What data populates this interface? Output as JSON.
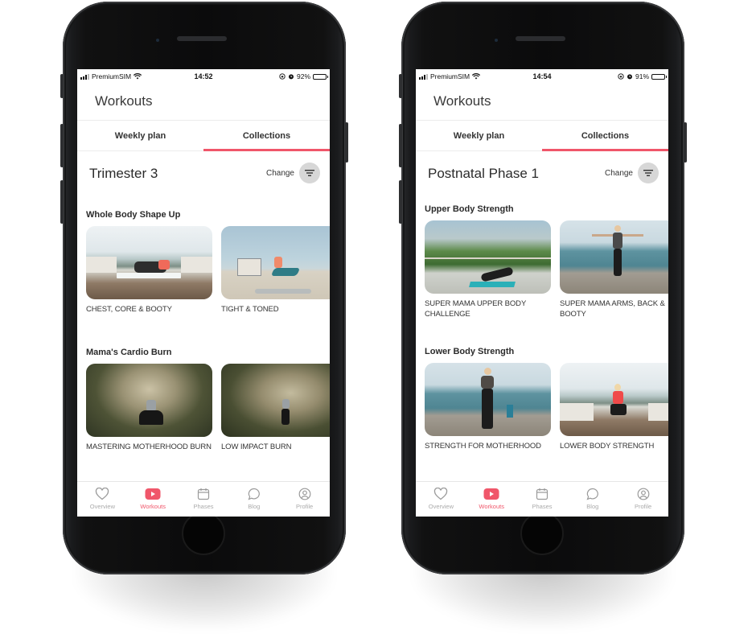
{
  "phones": [
    {
      "status": {
        "carrier": "PremiumSIM",
        "time": "14:52",
        "battery": "92%",
        "battery_level": 0.92
      },
      "header_title": "Workouts",
      "tabs": [
        {
          "label": "Weekly plan",
          "active": false
        },
        {
          "label": "Collections",
          "active": true
        }
      ],
      "phase_title": "Trimester 3",
      "change_label": "Change",
      "sections": [
        {
          "title": "Whole Body Shape Up",
          "cards": [
            {
              "label": "CHEST, CORE & BOOTY",
              "scene": "terrace"
            },
            {
              "label": "TIGHT & TONED",
              "scene": "beach"
            }
          ]
        },
        {
          "title": "Mama's Cardio Burn",
          "cards": [
            {
              "label": "MASTERING MOTHERHOOD BURN",
              "scene": "forest"
            },
            {
              "label": "LOW IMPACT BURN",
              "scene": "forest"
            }
          ]
        }
      ],
      "nav": [
        {
          "label": "Overview",
          "icon": "heart-icon",
          "active": false
        },
        {
          "label": "Workouts",
          "icon": "play-icon",
          "active": true
        },
        {
          "label": "Phases",
          "icon": "calendar-icon",
          "active": false
        },
        {
          "label": "Blog",
          "icon": "chat-bubble-icon",
          "active": false
        },
        {
          "label": "Profile",
          "icon": "profile-icon",
          "active": false
        }
      ]
    },
    {
      "status": {
        "carrier": "PremiumSIM",
        "time": "14:54",
        "battery": "91%",
        "battery_level": 0.91
      },
      "header_title": "Workouts",
      "tabs": [
        {
          "label": "Weekly plan",
          "active": false
        },
        {
          "label": "Collections",
          "active": true
        }
      ],
      "phase_title": "Postnatal Phase 1",
      "change_label": "Change",
      "sections": [
        {
          "title": "Upper Body Strength",
          "cards": [
            {
              "label": "SUPER MAMA UPPER BODY CHALLENGE",
              "scene": "hill"
            },
            {
              "label": "SUPER MAMA ARMS, BACK & BOOTY",
              "scene": "pier"
            }
          ]
        },
        {
          "title": "Lower Body Strength",
          "cards": [
            {
              "label": "STRENGTH FOR MOTHERHOOD",
              "scene": "pier"
            },
            {
              "label": "LOWER BODY STRENGTH",
              "scene": "terrace"
            }
          ]
        }
      ],
      "nav": [
        {
          "label": "Overview",
          "icon": "heart-icon",
          "active": false
        },
        {
          "label": "Workouts",
          "icon": "play-icon",
          "active": true
        },
        {
          "label": "Phases",
          "icon": "calendar-icon",
          "active": false
        },
        {
          "label": "Blog",
          "icon": "chat-bubble-icon",
          "active": false
        },
        {
          "label": "Profile",
          "icon": "profile-icon",
          "active": false
        }
      ]
    }
  ],
  "colors": {
    "accent": "#f0566a",
    "inactive_nav": "#aaaaaa",
    "filter_circle": "#d7d7d7"
  }
}
